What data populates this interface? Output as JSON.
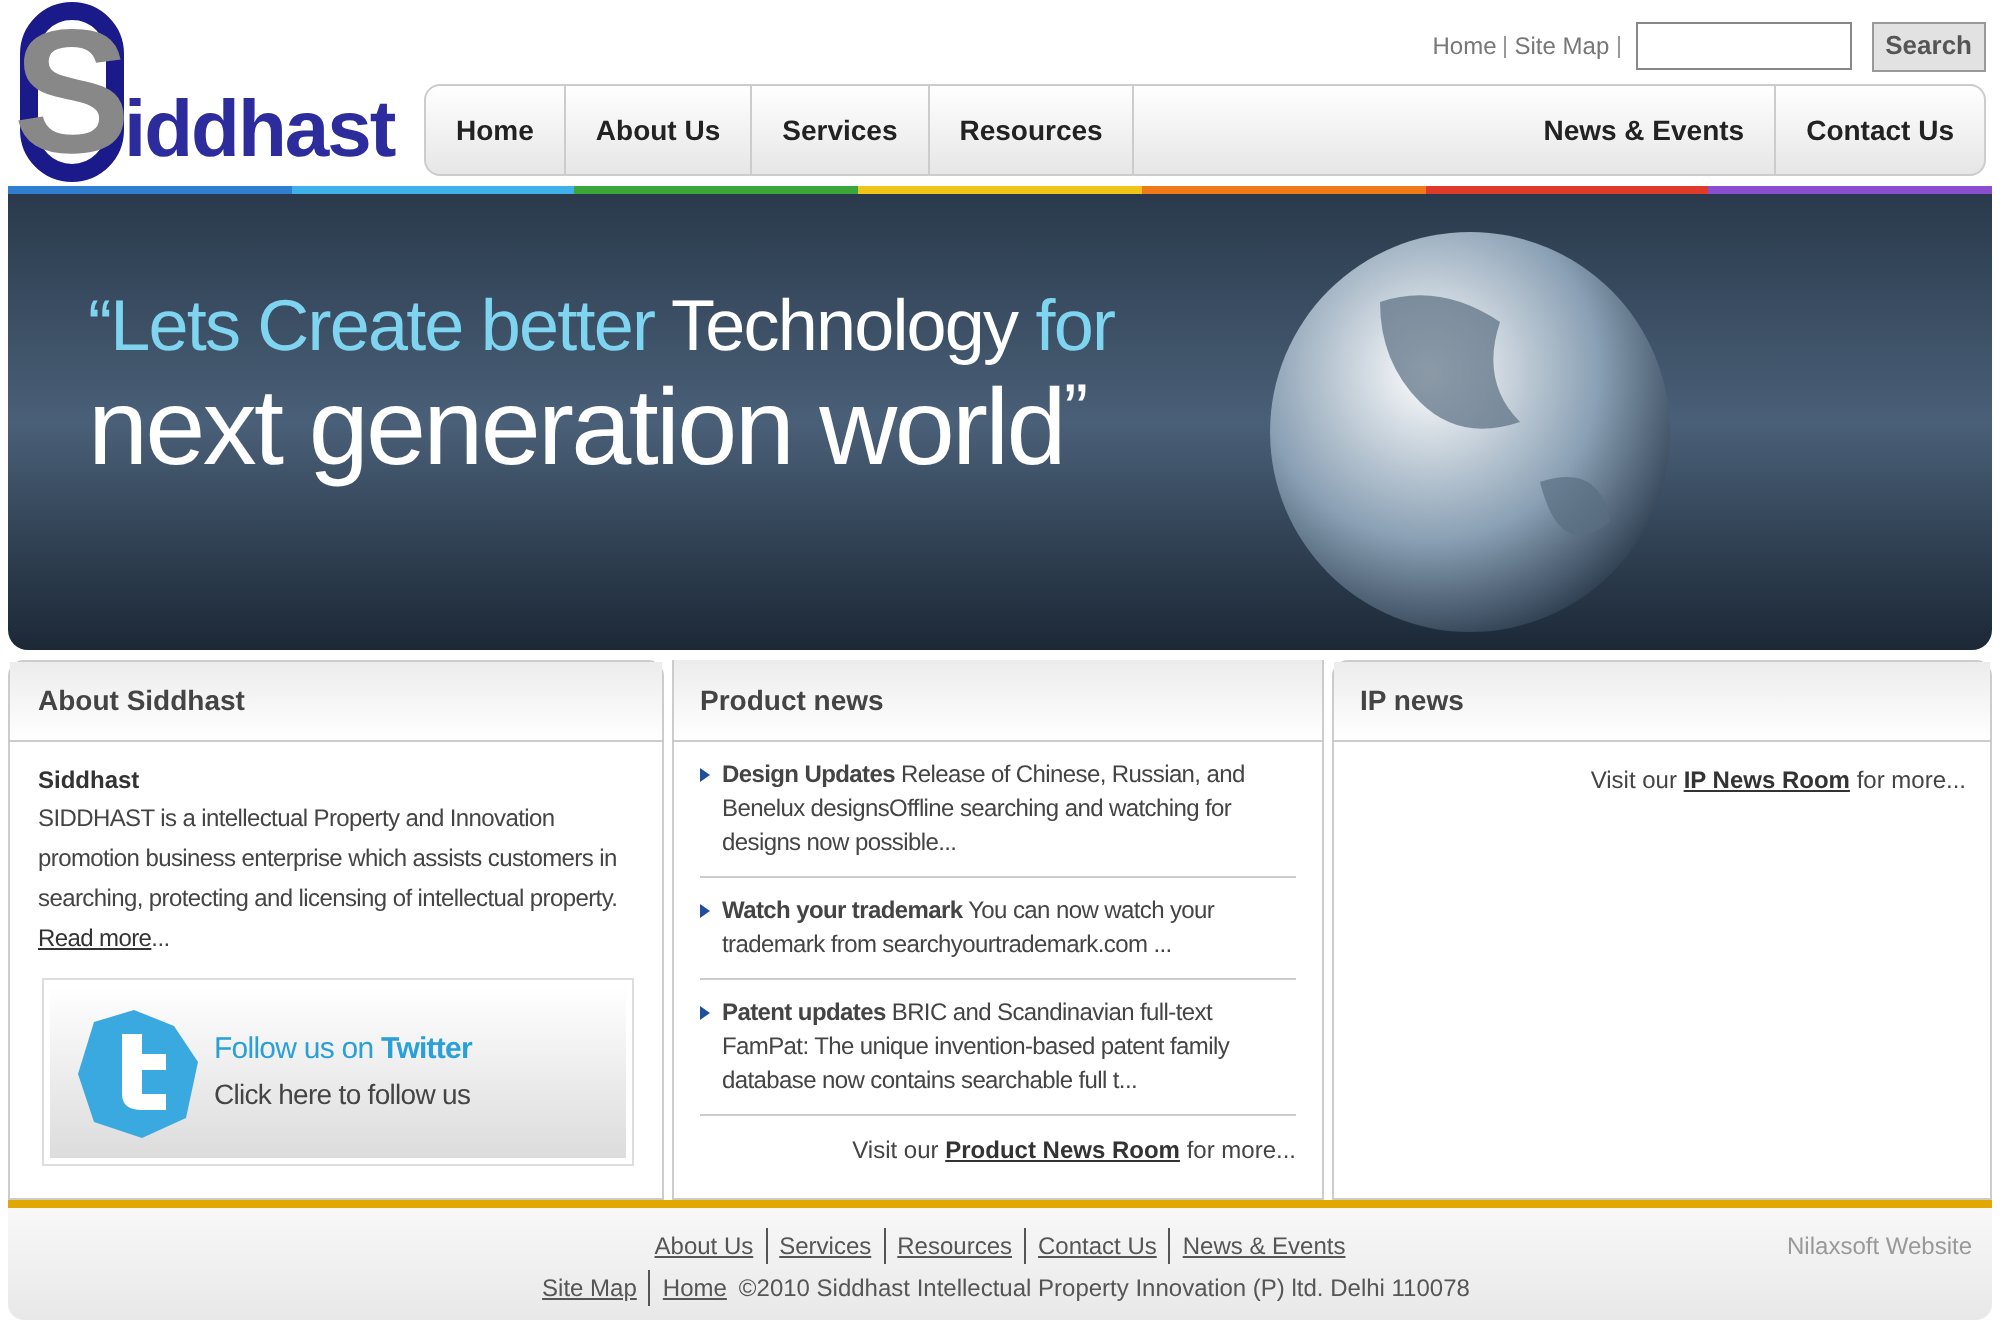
{
  "logo": {
    "letter": "S",
    "text": "iddhast"
  },
  "top_links": [
    "Home",
    "Site Map"
  ],
  "search": {
    "button": "Search"
  },
  "nav_left": [
    "Home",
    "About Us",
    "Services",
    "Resources"
  ],
  "nav_right": [
    "News & Events",
    "Contact Us"
  ],
  "stripe": [
    {
      "color": "#2f7fd0"
    },
    {
      "color": "#3fb0e8"
    },
    {
      "color": "#3aa63a"
    },
    {
      "color": "#f0c419"
    },
    {
      "color": "#f07a1a"
    },
    {
      "color": "#e03a2a"
    },
    {
      "color": "#8a4fd0"
    }
  ],
  "banner": {
    "quote_open": "“",
    "line1a": "Lets Create better",
    "line1b": "Technology",
    "line1c": "for",
    "line2": "next generation world",
    "quote_close": "”"
  },
  "about": {
    "heading": "About Siddhast",
    "title": "Siddhast",
    "text": "SIDDHAST is a intellectual Property and Innovation promotion business enterprise which assists customers in searching, protecting and licensing of intellectual property. ",
    "link": "Read more",
    "after": "...",
    "twitter_title_a": "Follow us on",
    "twitter_title_b": "Twitter",
    "twitter_sub": "Click here to follow us"
  },
  "product_news": {
    "heading": "Product news",
    "items": [
      "**Design Updates** Release of Chinese, Russian, and Benelux designsOffline searching and watching for designs now possible...",
      "**Watch your trademark** You can now watch your trademark from searchyourtrademark.com ...",
      "**Patent updates** BRIC and Scandinavian full-text FamPat: The unique invention-based patent family database now contains searchable full t..."
    ],
    "visit_before": "Visit our",
    "visit_link": "Product News Room",
    "visit_after": "for more..."
  },
  "ip_news": {
    "heading": "IP news",
    "visit_before": "Visit our",
    "visit_link": "IP News Room",
    "visit_after": "for more..."
  },
  "footer": {
    "links1": [
      "About Us",
      "Services",
      "Resources",
      "Contact Us",
      "News & Events"
    ],
    "links2": [
      "Site Map",
      "Home"
    ],
    "copyright": "©2010 Siddhast Intellectual Property Innovation (P) ltd. Delhi 110078",
    "credit": "Nilaxsoft Website"
  }
}
